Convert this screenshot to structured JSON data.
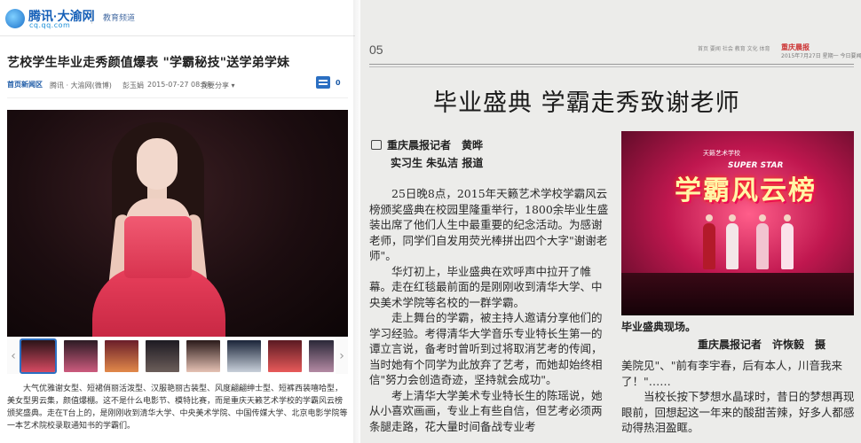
{
  "left": {
    "logo": {
      "main": "腾讯·大渝网",
      "sub": "cq.qq.com"
    },
    "channel": "教育频道",
    "headline": "艺校学生毕业走秀颜值爆表 \"学霸秘技\"送学弟学妹",
    "meta": {
      "tag": "首页新闻区",
      "source": "腾讯 · 大渝网(微博)",
      "author": "彭玉娟",
      "datetime": "2015-07-27 08:58",
      "share": "我要分享 ▾",
      "comments": "0"
    },
    "body": [
      "大气优雅谢女型、短裙俏丽活泼型、汉服艳丽古装型、风度翩翩绅士型、短裤西装嘻哈型，美女型男云集，颜值爆棚。这不是什么电影节、模特比赛，而是重庆天籁艺术学校的学霸风云榜颁奖盛典。走在T台上的，是刚刚收到清华大学、中央美术学院、中国传媒大学、北京电影学院等一本艺术院校录取通知书的学霸们。"
    ]
  },
  "right": {
    "page_number": "05",
    "toc": "首页  要闻  社会  教育  文化  体育",
    "masthead": "重庆晨报",
    "date": "2015年7月27日 星期一  今日要闻",
    "headline": "毕业盛典  学霸走秀致谢老师",
    "byline": {
      "line1": "重庆晨报记者　黄晔",
      "line2": "实习生 朱弘洁 报道"
    },
    "paragraphs": [
      "25日晚8点，2015年天籁艺术学校学霸风云榜颁奖盛典在校园里隆重举行，1800余毕业生盛装出席了他们人生中最重要的纪念活动。为感谢老师，同学们自发用荧光棒拼出四个大字\"谢谢老师\"。",
      "华灯初上，毕业盛典在欢呼声中拉开了帷幕。走在红毯最前面的是刚刚收到清华大学、中央美术学院等名校的一群学霸。",
      "走上舞台的学霸，被主持人邀请分享他们的学习经验。考得清华大学音乐专业特长生第一的谭立言说，备考时曾听到过将取消艺考的传闻，当时她有个同学为此放弃了艺考，而她却始终相信\"努力会创造奇迹，坚持就会成功\"。",
      "考上清华大学美术专业特长生的陈瑶说，她从小喜欢画画，专业上有些自信，但艺考必须两条腿走路，花大量时间备战专业考"
    ],
    "photo": {
      "logo": "天籁艺术学校",
      "title": "学霸风云榜",
      "subtitle": "SUPER STAR"
    },
    "caption": "毕业盛典现场。",
    "credit": "重庆晨报记者　许恢毅　摄",
    "paragraphs2": [
      "美院见\"、\"前有李宇春，后有本人，川音我来了！\"……",
      "当校长按下梦想水晶球时，昔日的梦想再现眼前，回想起这一年来的酸甜苦辣，好多人都感动得热泪盈眶。"
    ]
  }
}
